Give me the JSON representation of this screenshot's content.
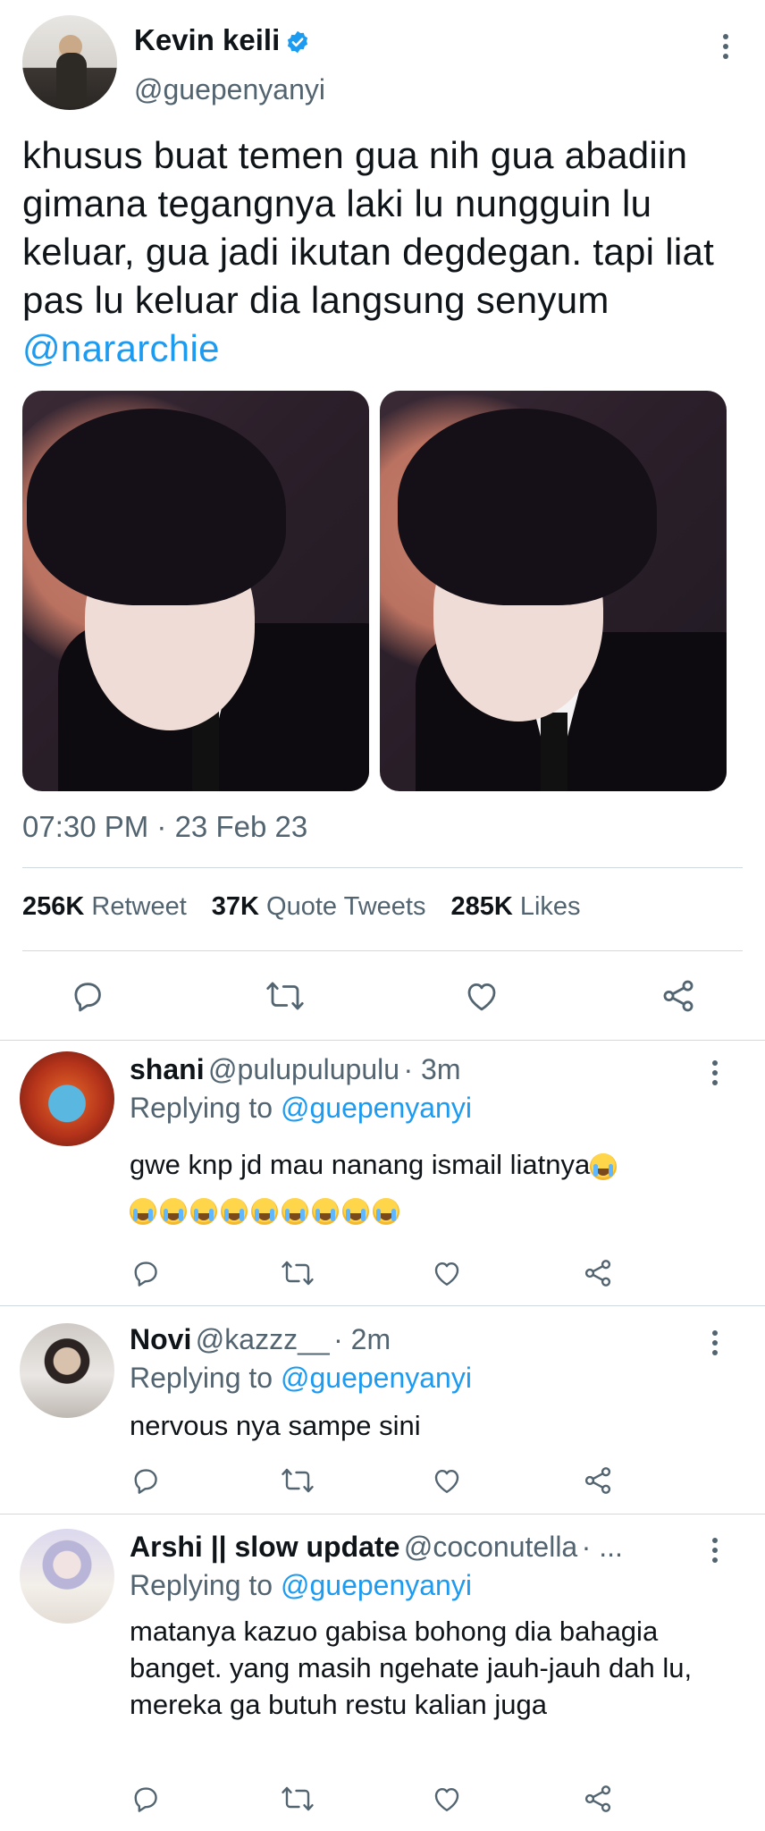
{
  "tweet": {
    "author_name": "Kevin keili",
    "author_handle": "@guepenyanyi",
    "text_before_mention": "khusus buat temen gua nih gua abadiin gimana tegangnya laki lu nungguin lu keluar, gua jadi ikutan degdegan. tapi liat pas lu keluar dia langsung senyum ",
    "mention": "@nararchie",
    "timestamp": "07:30 PM · 23 Feb 23",
    "stats": {
      "retweets_count": "256K",
      "retweets_label": "Retweet",
      "quotes_count": "37K",
      "quotes_label": "Quote Tweets",
      "likes_count": "285K",
      "likes_label": "Likes"
    }
  },
  "icons": {
    "verified": "verified-badge-icon",
    "more": "more-vertical-icon",
    "reply": "reply-icon",
    "retweet": "retweet-icon",
    "like": "heart-icon",
    "share": "share-icon",
    "crying": "loudly-crying-face-emoji"
  },
  "colors": {
    "accent": "#1d9bf0",
    "secondary_text": "#536471",
    "divider": "#cfd9de"
  },
  "replies": [
    {
      "name": "shani",
      "handle": "@pulupulupulu",
      "time": "· 3m",
      "replying_prefix": "Replying to ",
      "replying_to": "@guepenyanyi",
      "text": "gwe knp jd mau nanang ismail liatnya",
      "trailing_emoji_count": 1,
      "emoji_line_count": 9
    },
    {
      "name": "Novi",
      "handle": "@kazzz__",
      "time": "· 2m",
      "replying_prefix": "Replying to ",
      "replying_to": "@guepenyanyi",
      "text": "nervous nya sampe sini"
    },
    {
      "name": "Arshi || slow update",
      "handle": "@coconutella",
      "time": "· ...",
      "replying_prefix": "Replying to ",
      "replying_to": "@guepenyanyi",
      "text": "matanya kazuo gabisa bohong dia bahagia banget. yang masih ngehate jauh-jauh dah lu, mereka ga butuh restu kalian juga"
    }
  ]
}
